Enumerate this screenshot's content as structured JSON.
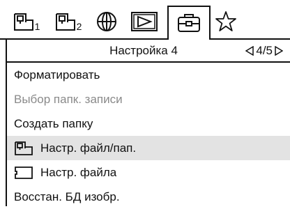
{
  "tabs": [
    {
      "icon": "card-slot-icon",
      "sub": "1"
    },
    {
      "icon": "card-slot-icon",
      "sub": "2"
    },
    {
      "icon": "globe-icon"
    },
    {
      "icon": "playback-icon"
    },
    {
      "icon": "toolbox-icon",
      "active": true
    },
    {
      "icon": "star-icon"
    }
  ],
  "header": {
    "title": "Настройка 4",
    "page": "4/5"
  },
  "menu": [
    {
      "label": "Форматировать",
      "state": "enabled"
    },
    {
      "label": "Выбор папк. записи",
      "state": "disabled"
    },
    {
      "label": "Создать папку",
      "state": "enabled"
    },
    {
      "label": "Настр. файл/пап.",
      "icon": "card-folder-icon",
      "state": "selected"
    },
    {
      "label": "Настр. файла",
      "icon": "card-outline-icon",
      "state": "enabled"
    },
    {
      "label": "Восстан. БД изобр.",
      "state": "enabled"
    }
  ],
  "colors": {
    "selected_bg": "#e3e3e3",
    "disabled_text": "#8a8a8a",
    "line": "#111111"
  }
}
